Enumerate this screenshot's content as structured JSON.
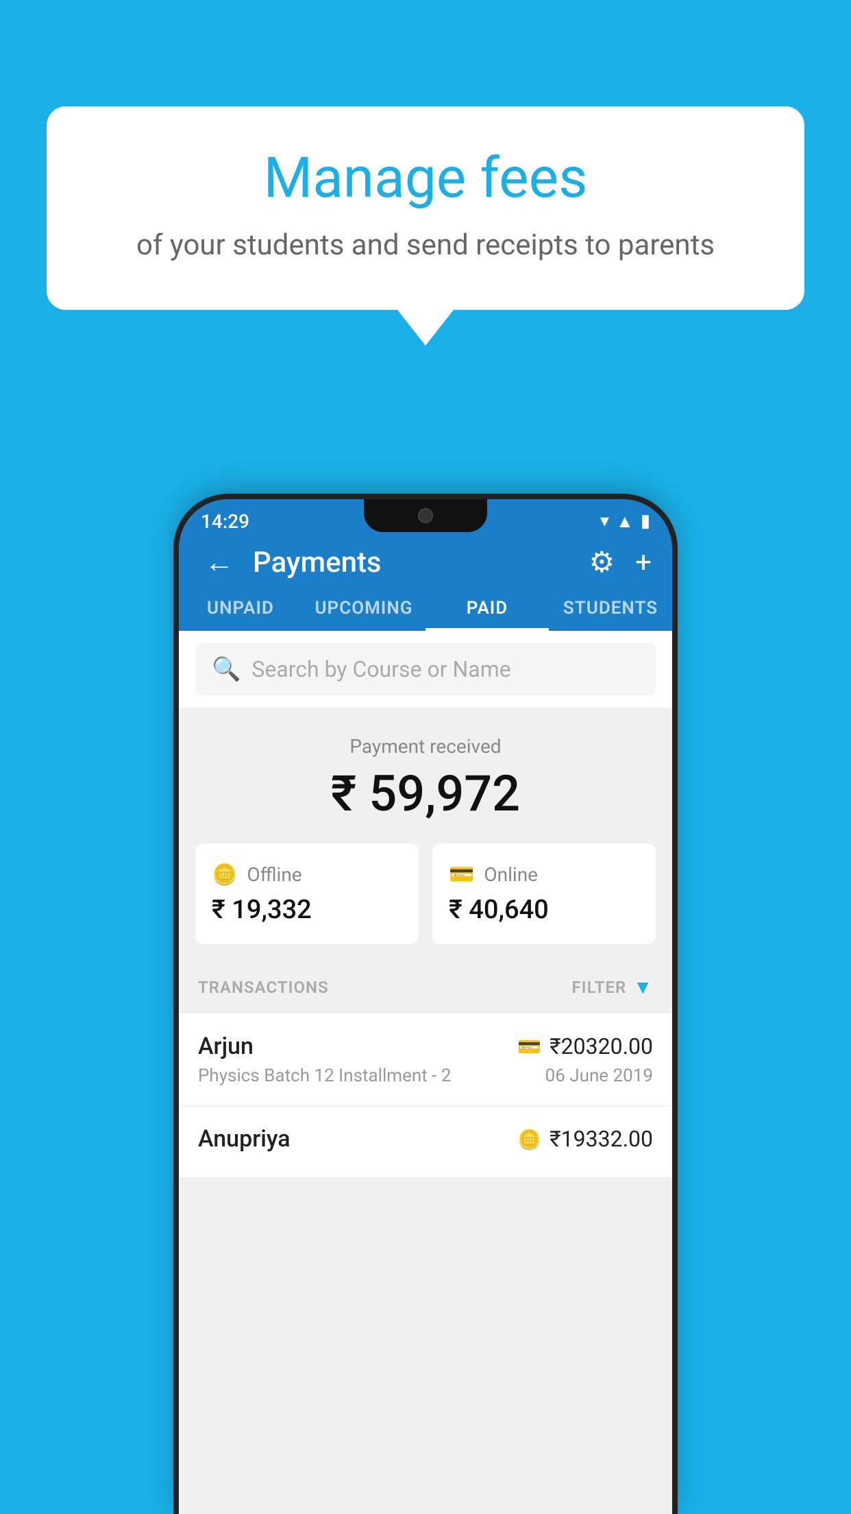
{
  "background": {
    "color": "#1AAFE6"
  },
  "speech_bubble": {
    "title": "Manage fees",
    "subtitle": "of your students and send receipts to parents"
  },
  "status_bar": {
    "time": "14:29",
    "icons": [
      "wifi",
      "signal",
      "battery"
    ]
  },
  "app_bar": {
    "title": "Payments",
    "back_label": "←",
    "gear_label": "⚙",
    "plus_label": "+"
  },
  "tabs": [
    {
      "label": "UNPAID",
      "active": false
    },
    {
      "label": "UPCOMING",
      "active": false
    },
    {
      "label": "PAID",
      "active": true
    },
    {
      "label": "STUDENTS",
      "active": false
    }
  ],
  "search": {
    "placeholder": "Search by Course or Name"
  },
  "payment_summary": {
    "label": "Payment received",
    "amount": "₹ 59,972",
    "offline": {
      "icon": "💴",
      "label": "Offline",
      "amount": "₹ 19,332"
    },
    "online": {
      "icon": "💳",
      "label": "Online",
      "amount": "₹ 40,640"
    }
  },
  "transactions": {
    "label": "TRANSACTIONS",
    "filter_label": "FILTER",
    "items": [
      {
        "name": "Arjun",
        "course": "Physics Batch 12 Installment - 2",
        "amount": "₹20320.00",
        "date": "06 June 2019",
        "payment_mode": "online"
      },
      {
        "name": "Anupriya",
        "course": "",
        "amount": "₹19332.00",
        "date": "",
        "payment_mode": "offline"
      }
    ]
  }
}
